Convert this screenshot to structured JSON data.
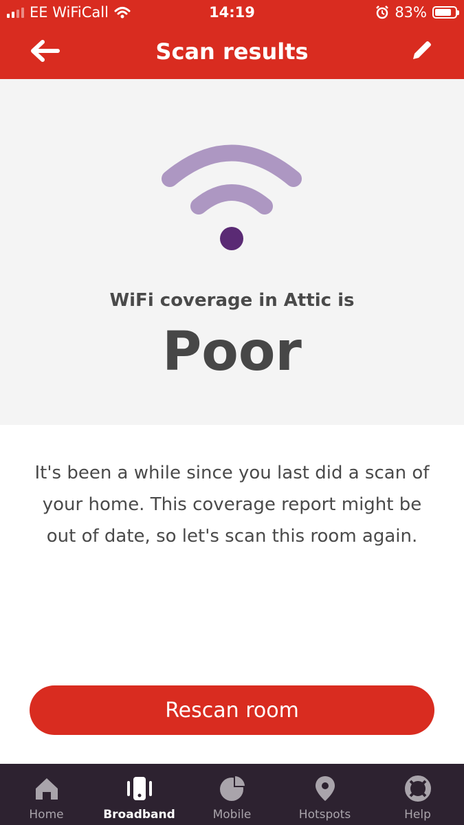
{
  "status_bar": {
    "carrier": "EE WiFiCall",
    "time": "14:19",
    "battery": "83%",
    "battery_level": 0.83
  },
  "header": {
    "title": "Scan results",
    "back_icon": "arrow-left-icon",
    "edit_icon": "pencil-icon"
  },
  "hero": {
    "coverage_label": "WiFi coverage in Attic is",
    "coverage_rating": "Poor",
    "wifi_icon": "wifi-signal-icon",
    "colors": {
      "arc": "#ad97c2",
      "dot": "#5a2a74"
    }
  },
  "message": "It's been a while since you last did a scan of your home. This coverage report might be out of date, so let's scan this room again.",
  "actions": {
    "rescan_label": "Rescan room"
  },
  "tabs": [
    {
      "label": "Home",
      "icon": "home-icon",
      "active": false
    },
    {
      "label": "Broadband",
      "icon": "router-icon",
      "active": true
    },
    {
      "label": "Mobile",
      "icon": "pie-chart-icon",
      "active": false
    },
    {
      "label": "Hotspots",
      "icon": "location-pin-icon",
      "active": false
    },
    {
      "label": "Help",
      "icon": "lifebuoy-icon",
      "active": false
    }
  ],
  "colors": {
    "brand": "#d92c20",
    "tabbar": "#2d2230",
    "hero_bg": "#f4f4f4"
  }
}
